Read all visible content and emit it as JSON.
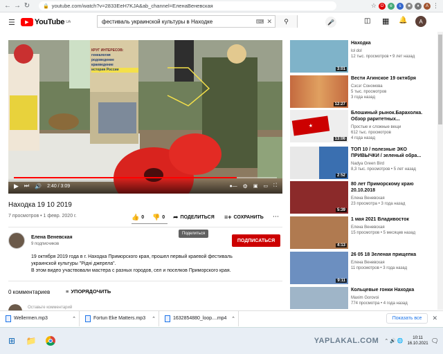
{
  "browser": {
    "url": "youtube.com/watch?v=2833EeH7KJA&ab_channel=ЕленаВеневская"
  },
  "header": {
    "logo_text": "YouTube",
    "logo_region": "UA",
    "search_value": "фестиваль украинской культуры в Находке",
    "avatar_letter": "A"
  },
  "video": {
    "time": "2:40 / 3:09",
    "progress": 0.847,
    "banner_line1": "КРУГ ИНТЕРЕСОВ:",
    "banner_items": [
      "генеалогия",
      "родоведение",
      "краеведение",
      "история России"
    ],
    "title": "Находка 19 10 2019",
    "meta": "7 просмотров • 1 февр. 2020 г.",
    "likes": "0",
    "dislikes": "0",
    "share_label": "ПОДЕЛИТЬСЯ",
    "save_label": "СОХРАНИТЬ",
    "tooltip": "Поделиться"
  },
  "channel": {
    "name": "Елена Веневская",
    "subs": "9 подписчиков",
    "subscribe_label": "ПОДПИСАТЬСЯ",
    "description": [
      "19 октября 2019 года в г. Находка Приморского края, прошел первый краевой фестиваль",
      "украинской культуры \"Рідні джерела\".",
      "В этом видео участвовали мастера с разных городов, сел и поселков  Приморского края."
    ]
  },
  "comments": {
    "count": "0 комментариев",
    "sort_label": "УПОРЯДОЧИТЬ",
    "placeholder": "Оставьте комментарий"
  },
  "sidebar": [
    {
      "title": "Находка",
      "line2": "",
      "channel": "lol dol",
      "meta": "12 тыс. просмотров • 9 лет назад",
      "duration": "3:01",
      "color": "#7fb3c9"
    },
    {
      "title": "Вести Агинское 19 октября",
      "line2": "",
      "channel": "Сэсэг Сономова",
      "meta": "5 тыс. просмотров",
      "meta2": "3 года назад",
      "duration": "12:27",
      "color": "#a85c3a"
    },
    {
      "title": "Блошиный рынок.Барахолка.",
      "line2": "Обзор раритетных...",
      "channel": "Простые и сложные вещи",
      "meta": "612 тыс. просмотров",
      "meta2": "4 года назад",
      "duration": "13:06",
      "color": "#d9d3c8"
    },
    {
      "title": "ТОП 10 / полезные ЭКО",
      "line2": "ПРИВЫЧКИ / зеленый обра...",
      "channel": "Nadya Green Bird",
      "meta": "8,3 тыс. просмотров • 5 лет назад",
      "duration": "2:52",
      "color": "#3a6fb0"
    },
    {
      "title": "80 лет Приморскому краю",
      "line2": "20.10.2018",
      "channel": "Елена Веневская",
      "meta": "23 просмотра • 3 года назад",
      "duration": "5:39",
      "color": "#8b2a2a"
    },
    {
      "title": "1 мая 2021 Владивосток",
      "line2": "",
      "channel": "Елена Веневская",
      "meta": "15 просмотров • 5 месяцев назад",
      "duration": "4:13",
      "color": "#b07a50"
    },
    {
      "title": "26 05 18 Зеленая прищепка",
      "line2": "",
      "channel": "Елена Веневская",
      "meta": "11 просмотров • 3 года назад",
      "duration": "9:11",
      "color": "#6c8fc0"
    },
    {
      "title": "Кольцевые гонки Находка",
      "line2": "",
      "channel": "Maxim Gorovoi",
      "meta": "774 просмотра • 4 года назад",
      "duration": "",
      "color": "#9fb5c8"
    }
  ],
  "downloads": {
    "files": [
      "Wellermen.mp3",
      "Fortun Eke Matters.mp3",
      "1632854880_loop....mp4"
    ],
    "show_all": "Показать все"
  },
  "taskbar": {
    "watermark": "YAPLAKAL.COM",
    "time": "10:11",
    "date": "16.10.2021"
  }
}
